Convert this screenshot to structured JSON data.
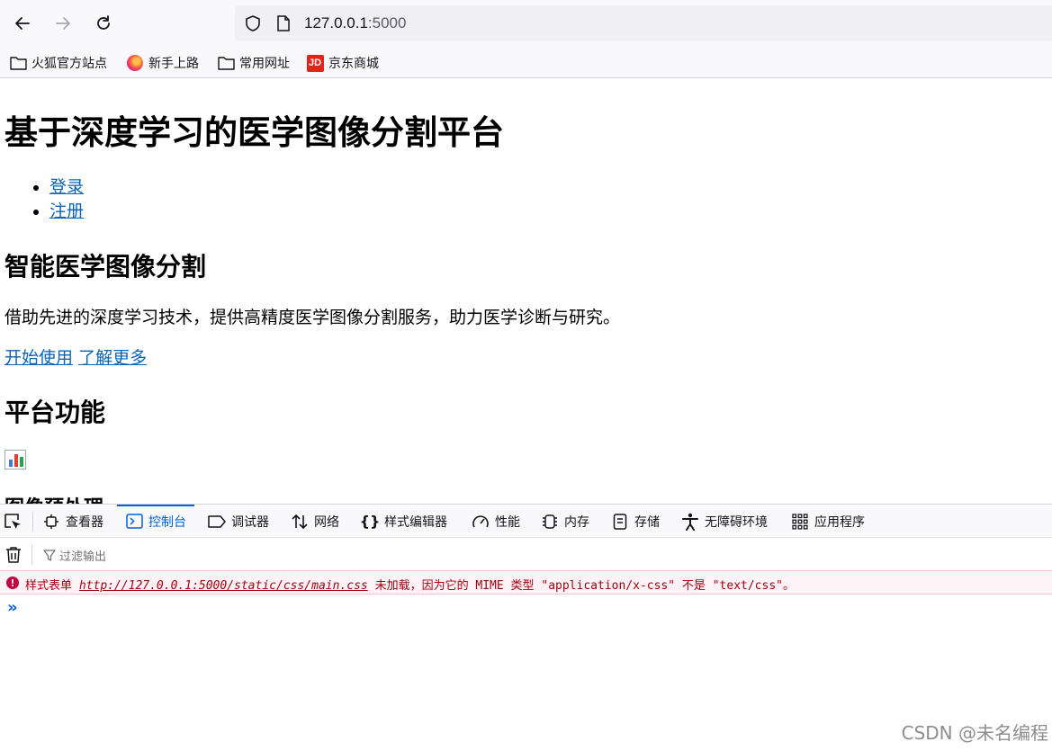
{
  "browser": {
    "url_host": "127.0.0.1",
    "url_port": ":5000",
    "bookmarks": [
      {
        "label": "火狐官方站点",
        "icon": "folder-icon"
      },
      {
        "label": "新手上路",
        "icon": "firefox-icon"
      },
      {
        "label": "常用网址",
        "icon": "folder-icon"
      },
      {
        "label": "京东商城",
        "icon": "jd-icon"
      }
    ]
  },
  "page": {
    "title": "基于深度学习的医学图像分割平台",
    "nav": [
      {
        "label": "登录"
      },
      {
        "label": "注册"
      }
    ],
    "hero_heading": "智能医学图像分割",
    "hero_desc": "借助先进的深度学习技术，提供高精度医学图像分割服务，助力医学诊断与研究。",
    "cta_start": "开始使用",
    "cta_more": "了解更多",
    "features_heading": "平台功能",
    "feature_icon": "bar-chart-emoji",
    "feature_title_partial": "图像预处理"
  },
  "devtools": {
    "tabs": [
      {
        "label": "查看器",
        "icon": "inspector-icon"
      },
      {
        "label": "控制台",
        "icon": "console-icon",
        "active": true
      },
      {
        "label": "调试器",
        "icon": "debugger-icon"
      },
      {
        "label": "网络",
        "icon": "network-icon"
      },
      {
        "label": "样式编辑器",
        "icon": "style-editor-icon"
      },
      {
        "label": "性能",
        "icon": "performance-icon"
      },
      {
        "label": "内存",
        "icon": "memory-icon"
      },
      {
        "label": "存储",
        "icon": "storage-icon"
      },
      {
        "label": "无障碍环境",
        "icon": "accessibility-icon"
      },
      {
        "label": "应用程序",
        "icon": "application-icon"
      }
    ],
    "filter_placeholder": "过滤输出",
    "error": {
      "prefix": "样式表单",
      "link": "http://127.0.0.1:5000/static/css/main.css",
      "suffix": "未加载，因为它的 MIME 类型 \"application/x-css\" 不是 \"text/css\"。"
    },
    "prompt_symbol": "»"
  },
  "watermark": "CSDN @未名编程",
  "colors": {
    "link": "#0b63b6",
    "accent": "#0060df",
    "error": "#a4000f",
    "error_bg": "#fdf2f5"
  }
}
